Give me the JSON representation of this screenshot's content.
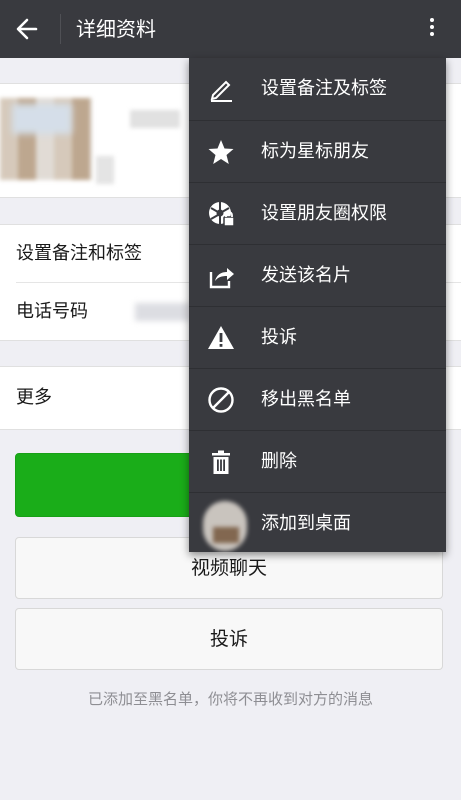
{
  "topbar": {
    "title": "详细资料"
  },
  "profile": {},
  "rows": {
    "remark_label": "设置备注和标签",
    "phone_label": "电话号码",
    "more_label": "更多"
  },
  "buttons": {
    "video_call": "视频聊天",
    "complain": "投诉"
  },
  "notice": "已添加至黑名单，你将不再收到对方的消息",
  "menu": {
    "items": [
      {
        "label": "设置备注及标签",
        "icon": "edit-pencil-icon"
      },
      {
        "label": "标为星标朋友",
        "icon": "star-icon"
      },
      {
        "label": "设置朋友圈权限",
        "icon": "moments-shutter-lock-icon"
      },
      {
        "label": "发送该名片",
        "icon": "share-icon"
      },
      {
        "label": "投诉",
        "icon": "warning-icon"
      },
      {
        "label": "移出黑名单",
        "icon": "block-icon"
      },
      {
        "label": "删除",
        "icon": "trash-icon"
      },
      {
        "label": "添加到桌面",
        "icon": "contact-avatar"
      }
    ]
  },
  "colors": {
    "topbar_bg": "#393a3f",
    "menu_bg": "#393a3f",
    "primary_green": "#1aad19",
    "page_bg": "#efeff4"
  }
}
